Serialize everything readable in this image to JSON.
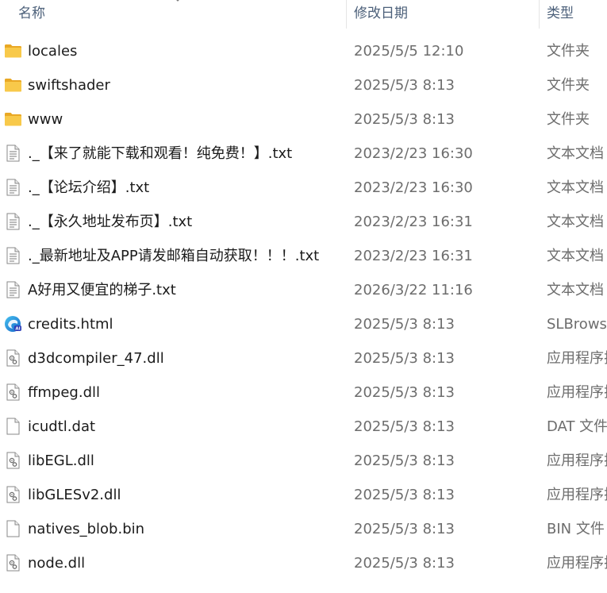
{
  "columns": {
    "name": "名称",
    "modified": "修改日期",
    "type": "类型"
  },
  "files": [
    {
      "icon": "folder-icon",
      "name": "locales",
      "modified": "2025/5/5 12:10",
      "type": "文件夹"
    },
    {
      "icon": "folder-icon",
      "name": "swiftshader",
      "modified": "2025/5/3 8:13",
      "type": "文件夹"
    },
    {
      "icon": "folder-icon",
      "name": "www",
      "modified": "2025/5/3 8:13",
      "type": "文件夹"
    },
    {
      "icon": "text-file-icon",
      "name": "._【来了就能下载和观看！纯免费！】.txt",
      "modified": "2023/2/23 16:30",
      "type": "文本文档"
    },
    {
      "icon": "text-file-icon",
      "name": "._【论坛介绍】.txt",
      "modified": "2023/2/23 16:30",
      "type": "文本文档"
    },
    {
      "icon": "text-file-icon",
      "name": "._【永久地址发布页】.txt",
      "modified": "2023/2/23 16:31",
      "type": "文本文档"
    },
    {
      "icon": "text-file-icon",
      "name": "._最新地址及APP请发邮箱自动获取！！！.txt",
      "modified": "2023/2/23 16:31",
      "type": "文本文档"
    },
    {
      "icon": "text-file-icon",
      "name": "A好用又便宜的梯子.txt",
      "modified": "2026/3/22 11:16",
      "type": "文本文档"
    },
    {
      "icon": "browser-html-icon",
      "name": "credits.html",
      "modified": "2025/5/3 8:13",
      "type": "SLBrowser"
    },
    {
      "icon": "dll-file-icon",
      "name": "d3dcompiler_47.dll",
      "modified": "2025/5/3 8:13",
      "type": "应用程序扩展"
    },
    {
      "icon": "dll-file-icon",
      "name": "ffmpeg.dll",
      "modified": "2025/5/3 8:13",
      "type": "应用程序扩展"
    },
    {
      "icon": "blank-file-icon",
      "name": "icudtl.dat",
      "modified": "2025/5/3 8:13",
      "type": "DAT 文件"
    },
    {
      "icon": "dll-file-icon",
      "name": "libEGL.dll",
      "modified": "2025/5/3 8:13",
      "type": "应用程序扩展"
    },
    {
      "icon": "dll-file-icon",
      "name": "libGLESv2.dll",
      "modified": "2025/5/3 8:13",
      "type": "应用程序扩展"
    },
    {
      "icon": "blank-file-icon",
      "name": "natives_blob.bin",
      "modified": "2025/5/3 8:13",
      "type": "BIN 文件"
    },
    {
      "icon": "dll-file-icon",
      "name": "node.dll",
      "modified": "2025/5/3 8:13",
      "type": "应用程序扩展"
    }
  ],
  "colors": {
    "folder": "#f8c94a",
    "header_text": "#4c607a",
    "meta_text": "#6d6d6d",
    "name_text": "#1b1b1b"
  }
}
